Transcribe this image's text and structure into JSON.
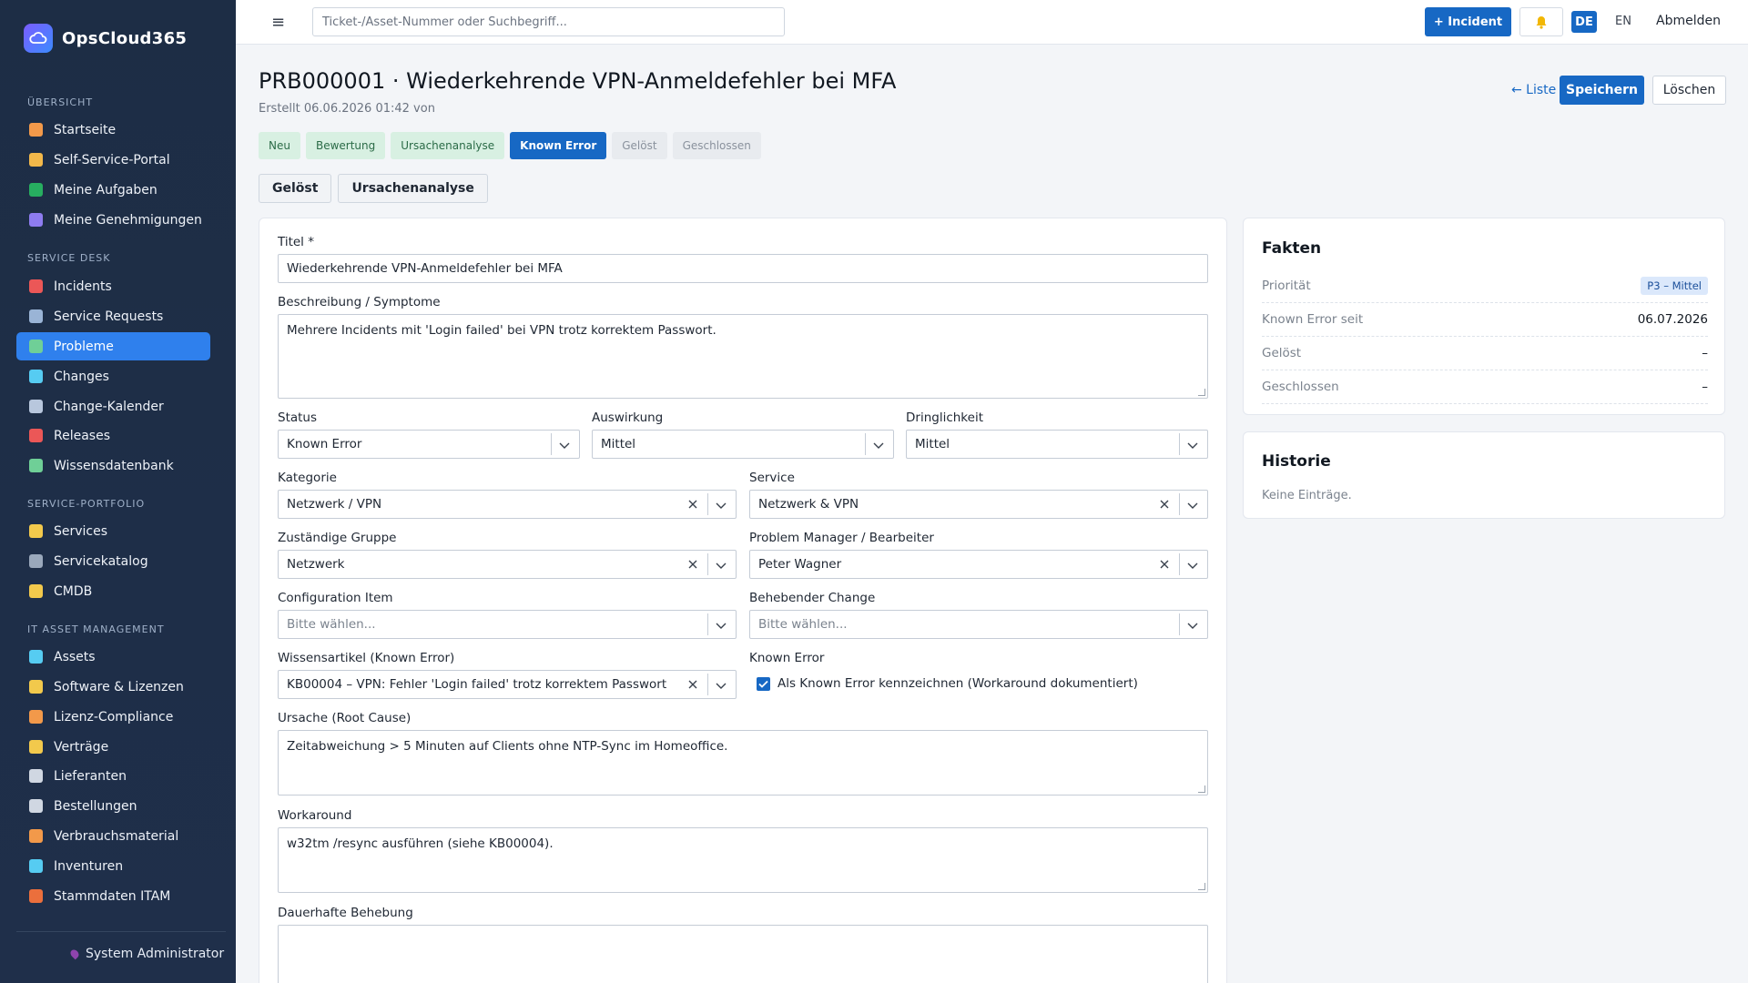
{
  "app": {
    "name": "OpsCloud365"
  },
  "sidebar": {
    "sections": [
      {
        "label": "ÜBERSICHT"
      },
      {
        "label": "SERVICE DESK"
      },
      {
        "label": "SERVICE-PORTFOLIO"
      },
      {
        "label": "IT ASSET MANAGEMENT"
      }
    ],
    "items": [
      {
        "label": "Startseite",
        "icon": "home-icon",
        "color": "#f2994a"
      },
      {
        "label": "Self-Service-Portal",
        "icon": "person-icon",
        "color": "#f2b84a"
      },
      {
        "label": "Meine Aufgaben",
        "icon": "checkbox-icon",
        "color": "#27ae60"
      },
      {
        "label": "Meine Genehmigungen",
        "icon": "check-icon",
        "color": "#8e7cf0"
      },
      {
        "label": "Incidents",
        "icon": "alarm-icon",
        "color": "#eb5757"
      },
      {
        "label": "Service Requests",
        "icon": "inbox-icon",
        "color": "#9ab4d6"
      },
      {
        "label": "Probleme",
        "icon": "puzzle-icon",
        "color": "#6fcf97"
      },
      {
        "label": "Changes",
        "icon": "refresh-icon",
        "color": "#56ccf2"
      },
      {
        "label": "Change-Kalender",
        "icon": "calendar-icon",
        "color": "#b8c7dd"
      },
      {
        "label": "Releases",
        "icon": "rocket-icon",
        "color": "#eb5757"
      },
      {
        "label": "Wissensdatenbank",
        "icon": "books-icon",
        "color": "#6fcf97"
      },
      {
        "label": "Services",
        "icon": "bell-service-icon",
        "color": "#f2c94c"
      },
      {
        "label": "Servicekatalog",
        "icon": "catalog-icon",
        "color": "#9aa8bb"
      },
      {
        "label": "CMDB",
        "icon": "folder-icon",
        "color": "#f2c94c"
      },
      {
        "label": "Assets",
        "icon": "monitor-icon",
        "color": "#56ccf2"
      },
      {
        "label": "Software & Lizenzen",
        "icon": "disc-icon",
        "color": "#f2c94c"
      },
      {
        "label": "Lizenz-Compliance",
        "icon": "scales-icon",
        "color": "#f2994a"
      },
      {
        "label": "Verträge",
        "icon": "contract-icon",
        "color": "#f2c94c"
      },
      {
        "label": "Lieferanten",
        "icon": "building-icon",
        "color": "#d0d7e2"
      },
      {
        "label": "Bestellungen",
        "icon": "clipboard-icon",
        "color": "#d0d7e2"
      },
      {
        "label": "Verbrauchsmaterial",
        "icon": "box-icon",
        "color": "#f2994a"
      },
      {
        "label": "Inventuren",
        "icon": "magnifier-icon",
        "color": "#56ccf2"
      },
      {
        "label": "Stammdaten ITAM",
        "icon": "bricks-icon",
        "color": "#eb6f3c"
      }
    ],
    "user": "System Administrator"
  },
  "topbar": {
    "search_placeholder": "Ticket-/Asset-Nummer oder Suchbegriff...",
    "incident_button": "+ Incident",
    "lang_de": "DE",
    "lang_en": "EN",
    "logout": "Abmelden"
  },
  "header": {
    "title": "PRB000001 · Wiederkehrende VPN-Anmeldefehler bei MFA",
    "subtitle": "Erstellt 06.06.2026 01:42 von",
    "back_link": "← Liste",
    "save": "Speichern",
    "delete": "Löschen"
  },
  "workflow": {
    "steps": [
      {
        "label": "Neu",
        "state": "done"
      },
      {
        "label": "Bewertung",
        "state": "done"
      },
      {
        "label": "Ursachenanalyse",
        "state": "done"
      },
      {
        "label": "Known Error",
        "state": "active"
      },
      {
        "label": "Gelöst",
        "state": "todo"
      },
      {
        "label": "Geschlossen",
        "state": "todo"
      }
    ],
    "actions": [
      "Gelöst",
      "Ursachenanalyse"
    ]
  },
  "form": {
    "title_label": "Titel *",
    "title_value": "Wiederkehrende VPN-Anmeldefehler bei MFA",
    "description_label": "Beschreibung / Symptome",
    "description_value": "Mehrere Incidents mit 'Login failed' bei VPN trotz korrektem Passwort.",
    "status_label": "Status",
    "status_value": "Known Error",
    "impact_label": "Auswirkung",
    "impact_value": "Mittel",
    "urgency_label": "Dringlichkeit",
    "urgency_value": "Mittel",
    "category_label": "Kategorie",
    "category_value": "Netzwerk / VPN",
    "service_label": "Service",
    "service_value": "Netzwerk & VPN",
    "group_label": "Zuständige Gruppe",
    "group_value": "Netzwerk",
    "manager_label": "Problem Manager / Bearbeiter",
    "manager_value": "Peter Wagner",
    "ci_label": "Configuration Item",
    "ci_placeholder": "Bitte wählen...",
    "change_label": "Behebender Change",
    "change_placeholder": "Bitte wählen...",
    "kb_label": "Wissensartikel (Known Error)",
    "kb_value": "KB00004 – VPN: Fehler 'Login failed' trotz korrektem Passwort",
    "known_error_label": "Known Error",
    "known_error_checkbox": "Als Known Error kennzeichnen (Workaround dokumentiert)",
    "known_error_checked": true,
    "root_cause_label": "Ursache (Root Cause)",
    "root_cause_value": "Zeitabweichung > 5 Minuten auf Clients ohne NTP-Sync im Homeoffice.",
    "workaround_label": "Workaround",
    "workaround_value": "w32tm /resync ausführen (siehe KB00004).",
    "permanent_fix_label": "Dauerhafte Behebung",
    "permanent_fix_value": ""
  },
  "facts": {
    "title": "Fakten",
    "rows": [
      {
        "key": "Priorität",
        "value": "P3 – Mittel",
        "badge": true
      },
      {
        "key": "Known Error seit",
        "value": "06.07.2026"
      },
      {
        "key": "Gelöst",
        "value": "–"
      },
      {
        "key": "Geschlossen",
        "value": "–"
      }
    ]
  },
  "history": {
    "title": "Historie",
    "empty": "Keine Einträge."
  }
}
